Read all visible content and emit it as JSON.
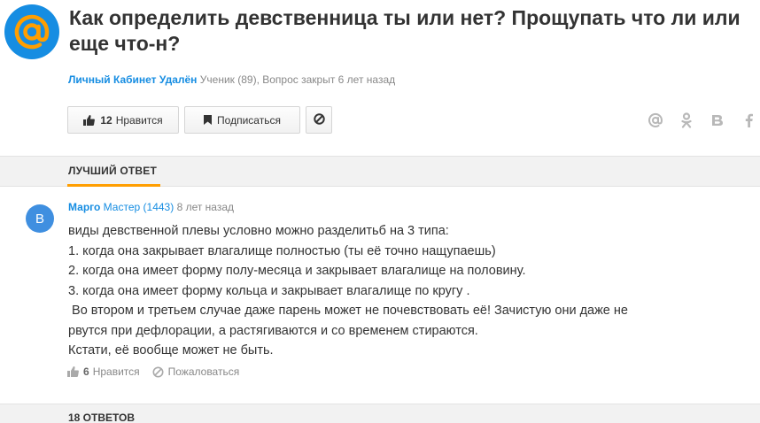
{
  "question": {
    "title": "Как определить девственница ты или нет? Прощупать что ли или еще что-н?",
    "author": "Личный Кабинет Удалён",
    "author_rank": "Ученик (89), Вопрос закрыт 6 лет назад"
  },
  "actions": {
    "like_count": "12",
    "like_label": "Нравится",
    "subscribe_label": "Подписаться"
  },
  "share_icons": [
    "at-icon",
    "odnoklassniki-icon",
    "vk-icon",
    "facebook-icon"
  ],
  "best_answer": {
    "section_label": "ЛУЧШИЙ ОТВЕТ",
    "avatar_letter": "В",
    "author": "Марго",
    "rank": "Мастер (1443)",
    "time": "8 лет назад",
    "lines": [
      "виды девственной плевы условно можно разделитьб на 3 типа:",
      "1. когда она закрывает влагалище полностью (ты её точно нащупаешь)",
      "2. когда она имеет форму полу-месяца и закрывает влагалище на половину.",
      "3. когда она имеет форму кольца и закрывает влагалище по кругу .",
      " Во втором и третьем случае даже парень может не почевствовать её! Зачистую они даже не",
      "рвутся при дефлорации, а растягиваются и со временем стираются.",
      "Кстати, её вообще может не быть."
    ],
    "like_count": "6",
    "like_label": "Нравится",
    "report_label": "Пожаловаться"
  },
  "answers_count_label": "18 ОТВЕТОВ",
  "colors": {
    "brand": "#168de2",
    "accent": "#ff9e00",
    "avatar": "#3f8fe0"
  }
}
